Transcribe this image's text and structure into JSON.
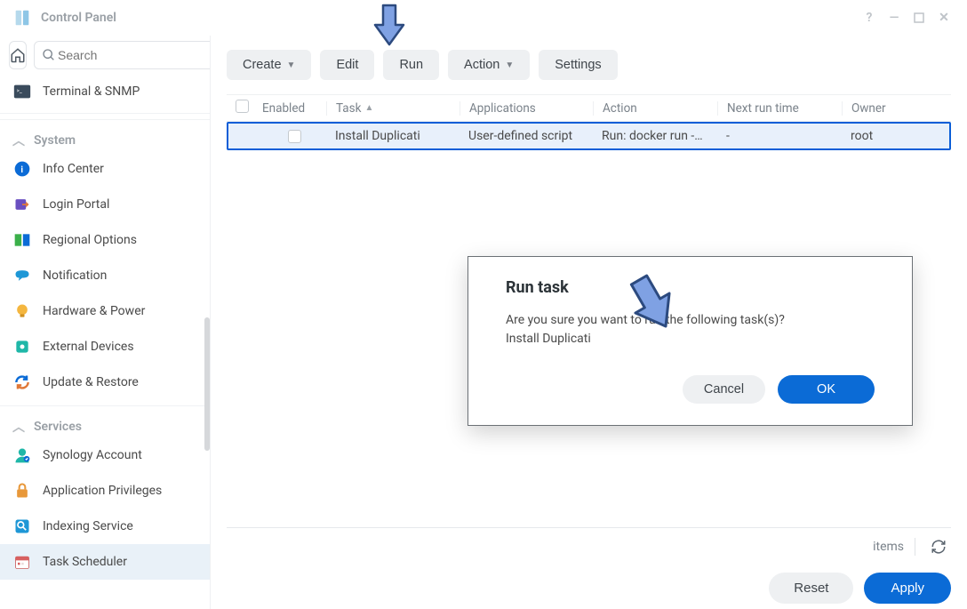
{
  "window_title": "Control Panel",
  "search": {
    "placeholder": "Search"
  },
  "sidebar": {
    "top_item": "Terminal & SNMP",
    "sections": {
      "system": {
        "label": "System",
        "items": [
          "Info Center",
          "Login Portal",
          "Regional Options",
          "Notification",
          "Hardware & Power",
          "External Devices",
          "Update & Restore"
        ]
      },
      "services": {
        "label": "Services",
        "items": [
          "Synology Account",
          "Application Privileges",
          "Indexing Service",
          "Task Scheduler"
        ]
      }
    }
  },
  "toolbar": {
    "create": "Create",
    "edit": "Edit",
    "run": "Run",
    "action": "Action",
    "settings": "Settings"
  },
  "table": {
    "columns": {
      "enabled": "Enabled",
      "task": "Task",
      "applications": "Applications",
      "action": "Action",
      "next_run": "Next run time",
      "owner": "Owner"
    },
    "rows": [
      {
        "enabled": false,
        "task": "Install Duplicati",
        "applications": "User-defined script",
        "action": "Run: docker run -…",
        "next_run": "-",
        "owner": "root"
      }
    ]
  },
  "footer": {
    "items_label": "items"
  },
  "buttons": {
    "reset": "Reset",
    "apply": "Apply"
  },
  "dialog": {
    "title": "Run task",
    "message": "Are you sure you want to run the following task(s)?",
    "task_name": "Install Duplicati",
    "cancel": "Cancel",
    "ok": "OK"
  }
}
